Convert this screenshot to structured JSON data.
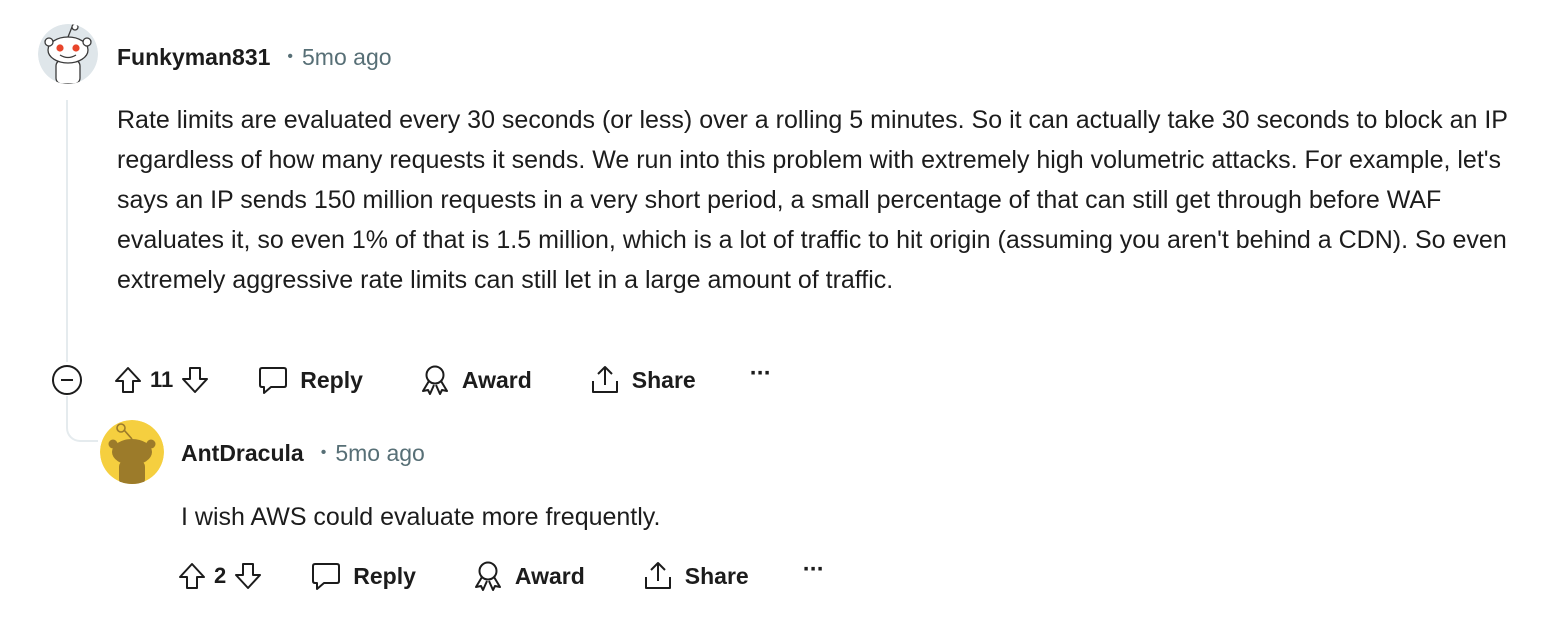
{
  "comments": [
    {
      "username": "Funkyman831",
      "separator": "•",
      "timestamp": "5mo ago",
      "avatar": "snoo-default-white-avatar",
      "body": "Rate limits are evaluated every 30 seconds (or less) over a rolling 5 minutes. So it can actually take 30 seconds to block an IP regardless of how many requests it sends. We run into this problem with extremely high volumetric attacks. For example, let's says an IP sends 150 million requests in a very short period, a small percentage of that can still get through before WAF evaluates it, so even 1% of that is 1.5 million, which is a lot of traffic to hit origin (assuming you aren't behind a CDN). So even extremely aggressive rate limits can still let in a large amount of traffic.",
      "score": "11",
      "actions": {
        "reply": "Reply",
        "award": "Award",
        "share": "Share",
        "more": "···"
      }
    },
    {
      "username": "AntDracula",
      "separator": "•",
      "timestamp": "5mo ago",
      "avatar": "snoo-yellow-avatar",
      "body": "I wish AWS could evaluate more frequently.",
      "score": "2",
      "actions": {
        "reply": "Reply",
        "award": "Award",
        "share": "Share",
        "more": "···"
      }
    }
  ],
  "colors": {
    "text": "#1c1c1c",
    "meta": "#576f76",
    "thread_line": "#e5ebee",
    "avatar_yellow": "#f5cf3f",
    "snoo_eye": "#e8452b"
  }
}
